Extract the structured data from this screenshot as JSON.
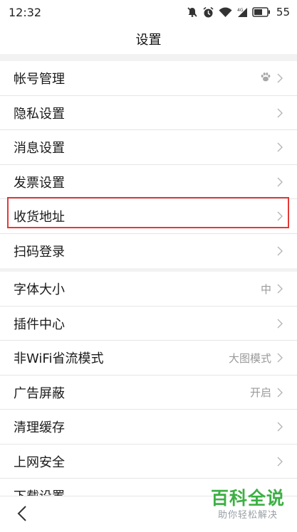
{
  "status_bar": {
    "time": "12:32",
    "battery": "55"
  },
  "header": {
    "title": "设置"
  },
  "group1": [
    {
      "label": "帐号管理",
      "icon": "paw-icon"
    },
    {
      "label": "隐私设置"
    },
    {
      "label": "消息设置"
    },
    {
      "label": "发票设置"
    },
    {
      "label": "收货地址"
    },
    {
      "label": "扫码登录"
    }
  ],
  "group2": [
    {
      "label": "字体大小",
      "value": "中"
    },
    {
      "label": "插件中心"
    },
    {
      "label": "非WiFi省流模式",
      "value": "大图模式"
    },
    {
      "label": "广告屏蔽",
      "value": "开启"
    },
    {
      "label": "清理缓存"
    },
    {
      "label": "上网安全"
    },
    {
      "label": "下载设置"
    }
  ],
  "watermark": {
    "title": "百科全说",
    "subtitle": "助你轻松解决"
  },
  "colors": {
    "highlight": "#e53935",
    "watermark": "#3cb043"
  }
}
